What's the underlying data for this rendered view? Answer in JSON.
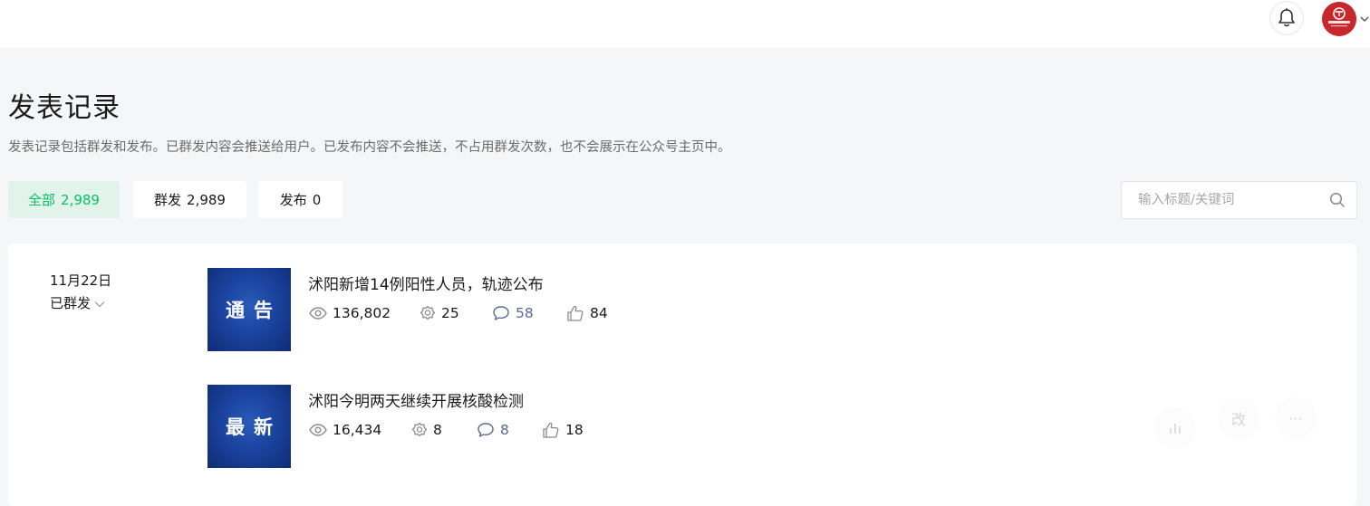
{
  "header": {
    "notification_icon": "bell-icon",
    "avatar_icon": "account-avatar",
    "avatar_caret_icon": "chevron-down-icon"
  },
  "page": {
    "title": "发表记录",
    "description": "发表记录包括群发和发布。已群发内容会推送给用户。已发布内容不会推送，不占用群发次数，也不会展示在公众号主页中。"
  },
  "tabs": [
    {
      "label": "全部",
      "count": "2,989",
      "active": true
    },
    {
      "label": "群发",
      "count": "2,989",
      "active": false
    },
    {
      "label": "发布",
      "count": "0",
      "active": false
    }
  ],
  "search": {
    "placeholder": "输入标题/关键词",
    "icon": "search-icon"
  },
  "group": {
    "date": "11月22日",
    "status": "已群发",
    "articles": [
      {
        "thumb_text": "通告",
        "title": "沭阳新增14例阳性人员，轨迹公布",
        "views": "136,802",
        "shares": "25",
        "comments": "58",
        "likes": "84"
      },
      {
        "thumb_text": "最新",
        "title": "沭阳今明两天继续开展核酸检测",
        "views": "16,434",
        "shares": "8",
        "comments": "8",
        "likes": "18"
      }
    ],
    "actions": {
      "stats_icon": "bar-chart-icon",
      "edit_label": "改",
      "more_label": "···"
    }
  },
  "colors": {
    "accent": "#07c160",
    "active_tab_bg": "#e1f3ea",
    "comment_link": "#576b95",
    "avatar_bg": "#c8272c",
    "thumb_bg": "#1b43a0"
  }
}
